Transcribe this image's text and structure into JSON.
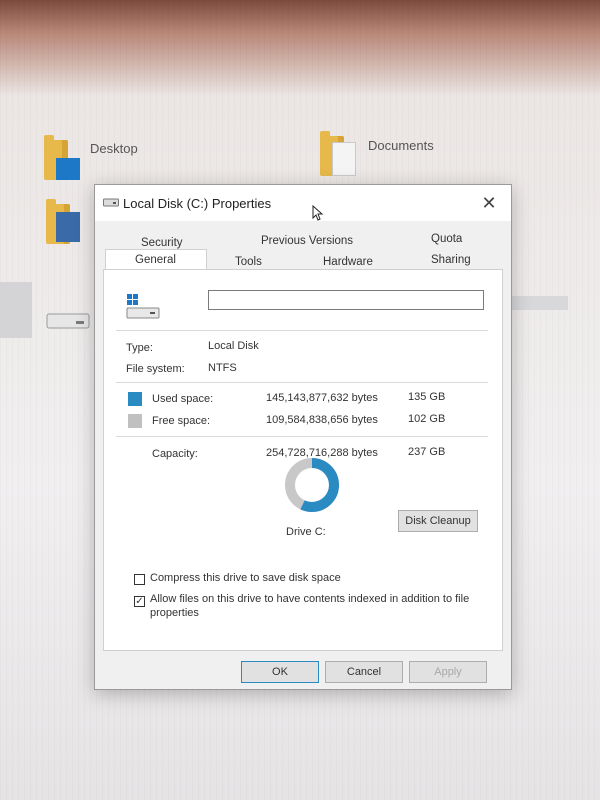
{
  "desktop": {
    "icons": [
      {
        "label": "Desktop"
      },
      {
        "label": "Documents"
      }
    ]
  },
  "dialog": {
    "title": "Local Disk (C:) Properties",
    "tabs_row1": [
      "Security",
      "Previous Versions",
      "Quota"
    ],
    "tabs_row2": [
      "General",
      "Tools",
      "Hardware",
      "Sharing"
    ],
    "active_tab": "General",
    "name_value": "",
    "type_label": "Type:",
    "type_value": "Local Disk",
    "fs_label": "File system:",
    "fs_value": "NTFS",
    "used": {
      "label": "Used space:",
      "bytes": "145,143,877,632 bytes",
      "size": "135 GB",
      "color": "#2a8ac2"
    },
    "free": {
      "label": "Free space:",
      "bytes": "109,584,838,656 bytes",
      "size": "102 GB",
      "color": "#c0c0c0"
    },
    "capacity": {
      "label": "Capacity:",
      "bytes": "254,728,716,288 bytes",
      "size": "237 GB"
    },
    "used_fraction": 0.57,
    "drive_label": "Drive C:",
    "disk_cleanup_label": "Disk Cleanup",
    "compress_label": "Compress this drive to save disk space",
    "compress_checked": false,
    "index_label": "Allow files on this drive to have contents indexed in addition to file properties",
    "index_checked": true,
    "ok_label": "OK",
    "cancel_label": "Cancel",
    "apply_label": "Apply",
    "accent_color": "#2a8ac2"
  }
}
